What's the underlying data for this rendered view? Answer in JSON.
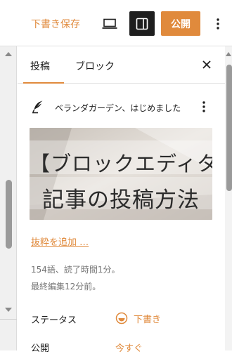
{
  "toolbar": {
    "save_draft_label": "下書き保存",
    "preview_icon": "laptop-icon",
    "settings_icon": "sidebar-toggle-icon",
    "publish_label": "公開",
    "options_icon": "vertical-ellipsis-icon"
  },
  "sidebar": {
    "tabs": [
      {
        "label": "投稿",
        "active": true
      },
      {
        "label": "ブロック",
        "active": false
      }
    ],
    "close_icon": "close-icon",
    "post": {
      "icon": "feather-icon",
      "title": "ベランダガーデン、はじめました",
      "menu_icon": "vertical-ellipsis-icon"
    },
    "featured_image": {
      "line1": "【ブロックエディタ】",
      "line2": "記事の投稿方法"
    },
    "excerpt_link": "抜粋を追加 …",
    "meta": {
      "words": "154語、読了時間1分。",
      "edited": "最終編集12分前。"
    },
    "status": {
      "label": "ステータス",
      "value": "下書き",
      "icon": "draft-status-icon"
    },
    "publish": {
      "label": "公開",
      "value": "今すぐ"
    }
  },
  "colors": {
    "accent": "#e08a3c",
    "dark": "#1e1e1e",
    "muted": "#757575"
  }
}
